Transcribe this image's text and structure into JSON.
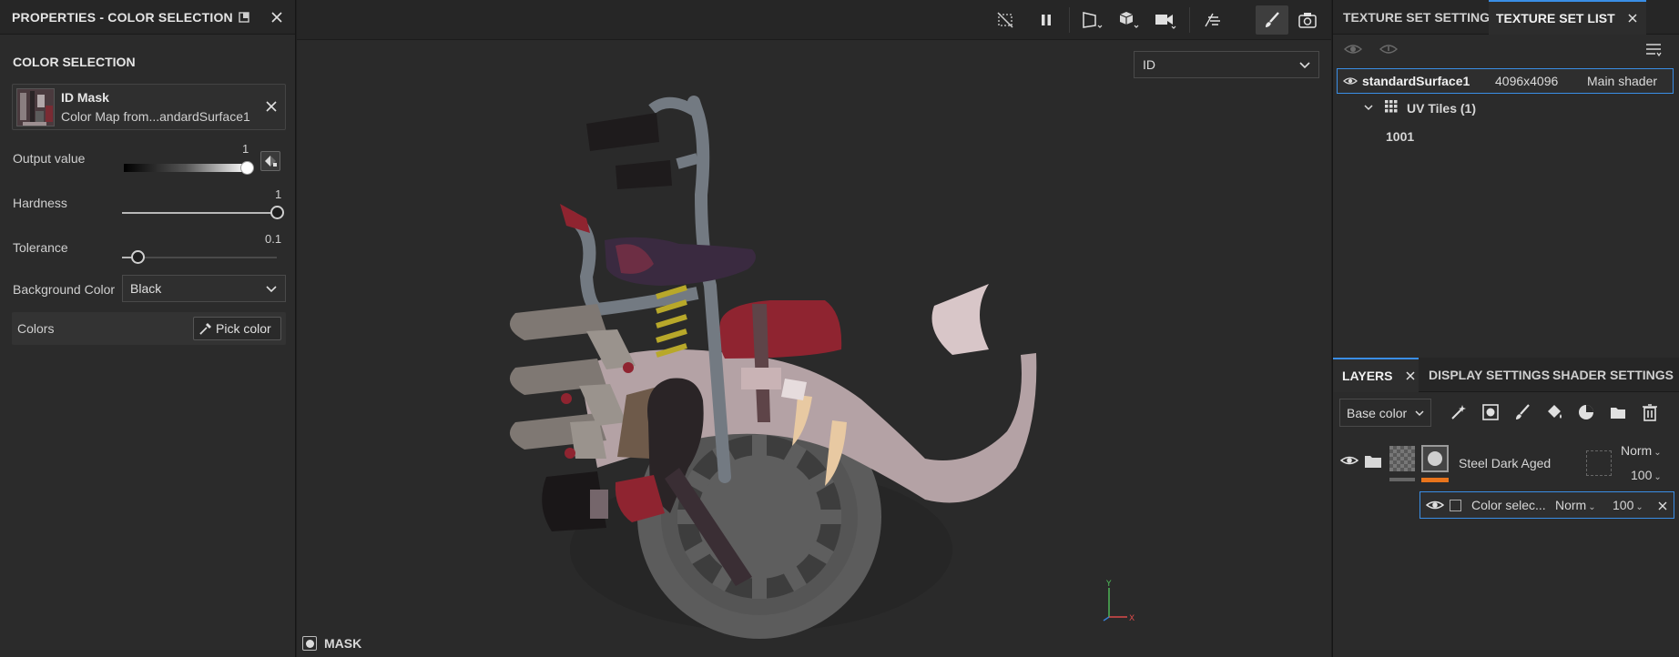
{
  "properties_panel": {
    "title": "PROPERTIES - COLOR SELECTION",
    "section_title": "COLOR SELECTION",
    "mask": {
      "name": "ID Mask",
      "source": "Color Map from...andardSurface1"
    },
    "output_value": {
      "label": "Output value",
      "value": "1",
      "fraction": 1.0
    },
    "hardness": {
      "label": "Hardness",
      "value": "1",
      "fraction": 1.0
    },
    "tolerance": {
      "label": "Tolerance",
      "value": "0.1",
      "fraction": 0.1
    },
    "background_color": {
      "label": "Background Color",
      "value": "Black"
    },
    "colors": {
      "label": "Colors",
      "button_label": "Pick color"
    }
  },
  "viewport": {
    "channel_select": "ID",
    "mask_label": "MASK",
    "axis_y": "Y",
    "axis_x": "X",
    "toolbar_icons": [
      "hide-icon",
      "pause-icon",
      "camera-perspective-icon",
      "cube-icon",
      "video-camera-icon",
      "symmetry-icon",
      "paint-brush-icon",
      "screenshot-icon"
    ]
  },
  "texture_set_panel": {
    "tabs": [
      {
        "label": "TEXTURE SET SETTINGS"
      },
      {
        "label": "TEXTURE SET LIST"
      }
    ],
    "row": {
      "name": "standardSurface1",
      "resolution": "4096x4096",
      "shader": "Main shader"
    },
    "uv_tiles": "UV Tiles (1)",
    "uv_tile": "1001"
  },
  "layers_panel": {
    "tabs": [
      {
        "label": "LAYERS"
      },
      {
        "label": "DISPLAY SETTINGS"
      },
      {
        "label": "SHADER SETTINGS"
      }
    ],
    "channel_dropdown": "Base color",
    "layer": {
      "name": "Steel Dark Aged",
      "blend": "Norm",
      "opacity": "100"
    },
    "effect": {
      "name": "Color selec...",
      "blend": "Norm",
      "opacity": "100"
    }
  },
  "colors": {
    "accent": "#3a8ee6",
    "mask_bar": "#e8741c",
    "panel_bg": "#2b2b2b",
    "viewport_bg": "#2a2a2a"
  }
}
